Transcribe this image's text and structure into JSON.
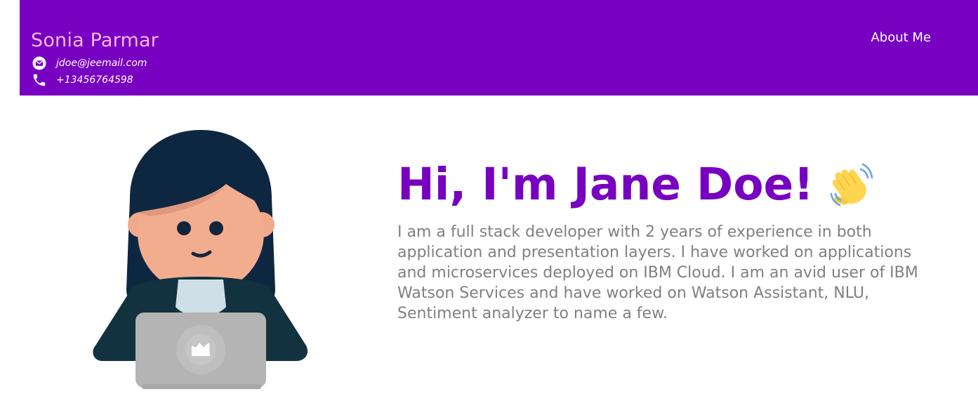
{
  "header": {
    "name": "Sonia Parmar",
    "email": "jdoe@jeemail.com",
    "phone": "+13456764598",
    "nav": [
      {
        "label": "About Me"
      }
    ],
    "background": "#7700c1",
    "name_color": "#f6b8de"
  },
  "hero": {
    "title": "Hi, I'm Jane Doe!",
    "emoji": "waving-hand",
    "description": "I am a full stack developer with 2 years of experience in both application and presentation layers. I have worked on applications and microservices deployed on IBM Cloud. I am an avid user of IBM Watson Services and have worked on Watson Assistant, NLU, Sentiment analyzer to name a few.",
    "title_color": "#7700c1",
    "text_color": "#808080"
  },
  "icons": {
    "email": "email-icon",
    "phone": "phone-icon",
    "avatar": "developer-avatar-illustration",
    "wave": "waving-hand-icon"
  }
}
